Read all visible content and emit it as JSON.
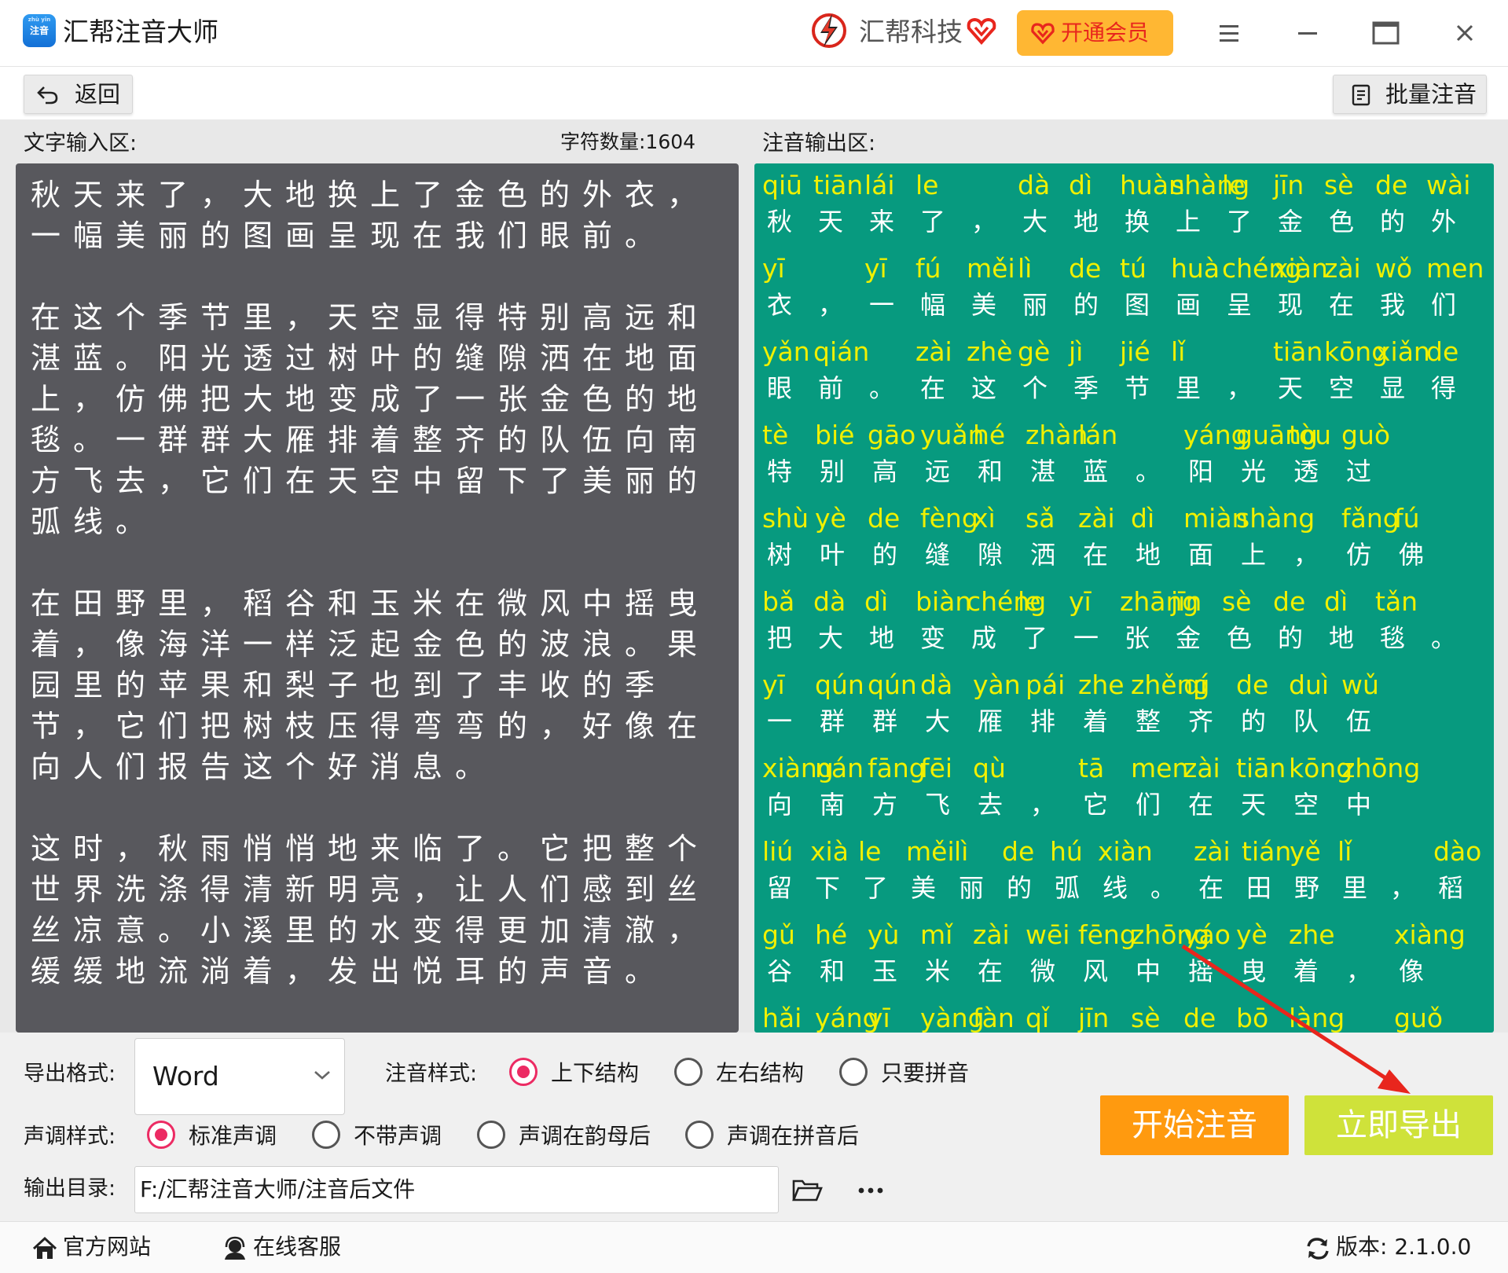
{
  "app": {
    "logo_text": "注音",
    "logo_pinyin": "zhù yīn",
    "title": "汇帮注音大师"
  },
  "brand": {
    "name": "汇帮科技",
    "vip_label": "开通会员"
  },
  "toolbar": {
    "back_label": "返回",
    "batch_label": "批量注音"
  },
  "input": {
    "label": "文字输入区:",
    "char_count": "字符数量:1604",
    "text": "秋天来了，大地换上了金色的外衣，一幅美丽的图画呈现在我们眼前。\n\n在这个季节里，天空显得特别高远和湛蓝。阳光透过树叶的缝隙洒在地面上，仿佛把大地变成了一张金色的地毯。一群群大雁排着整齐的队伍向南方飞去，它们在天空中留下了美丽的弧线。\n\n在田野里，稻谷和玉米在微风中摇曳着，像海洋一样泛起金色的波浪。果园里的苹果和梨子也到了丰收的季节，它们把树枝压得弯弯的，好像在向人们报告这个好消息。\n\n这时，秋雨悄悄地来临了。它把整个世界洗涤得清新明亮，让人们感到丝丝凉意。小溪里的水变得更加清澈，缓缓地流淌着，发出悦耳的声音。"
  },
  "output": {
    "label": "注音输出区:",
    "rows": [
      {
        "pinyin": [
          "qiū",
          "tiān",
          "lái",
          "le",
          "",
          "dà",
          "dì",
          "huàn",
          "shàng",
          "le",
          "jīn",
          "sè",
          "de",
          "wài"
        ],
        "hanzi": [
          "秋",
          "天",
          "来",
          "了",
          "，",
          "大",
          "地",
          "换",
          "上",
          "了",
          "金",
          "色",
          "的",
          "外"
        ]
      },
      {
        "pinyin": [
          "yī",
          "",
          "yī",
          "fú",
          "měi",
          "lì",
          "de",
          "tú",
          "huà",
          "chéng",
          "xiàn",
          "zài",
          "wǒ",
          "men"
        ],
        "hanzi": [
          "衣",
          "，",
          "一",
          "幅",
          "美",
          "丽",
          "的",
          "图",
          "画",
          "呈",
          "现",
          "在",
          "我",
          "们"
        ]
      },
      {
        "pinyin": [
          "yǎn",
          "qián",
          "",
          "zài",
          "zhè",
          "gè",
          "jì",
          "jié",
          "lǐ",
          "",
          "tiān",
          "kōng",
          "xiǎn",
          "de"
        ],
        "hanzi": [
          "眼",
          "前",
          "。",
          "在",
          "这",
          "个",
          "季",
          "节",
          "里",
          "，",
          "天",
          "空",
          "显",
          "得"
        ]
      },
      {
        "pinyin": [
          "tè",
          "bié",
          "gāo",
          "yuǎn",
          "hé",
          "zhàn",
          "lán",
          "",
          "yáng",
          "guāng",
          "tòu",
          "guò"
        ],
        "hanzi": [
          "特",
          "别",
          "高",
          "远",
          "和",
          "湛",
          "蓝",
          "。",
          "阳",
          "光",
          "透",
          "过"
        ]
      },
      {
        "pinyin": [
          "shù",
          "yè",
          "de",
          "fèng",
          "xì",
          "sǎ",
          "zài",
          "dì",
          "miàn",
          "shàng",
          "",
          "fǎng",
          "fú"
        ],
        "hanzi": [
          "树",
          "叶",
          "的",
          "缝",
          "隙",
          "洒",
          "在",
          "地",
          "面",
          "上",
          "，",
          "仿",
          "佛"
        ]
      },
      {
        "pinyin": [
          "bǎ",
          "dà",
          "dì",
          "biàn",
          "chéng",
          "le",
          "yī",
          "zhāng",
          "jīn",
          "sè",
          "de",
          "dì",
          "tǎn",
          ""
        ],
        "hanzi": [
          "把",
          "大",
          "地",
          "变",
          "成",
          "了",
          "一",
          "张",
          "金",
          "色",
          "的",
          "地",
          "毯",
          "。"
        ]
      },
      {
        "pinyin": [
          "yī",
          "qún",
          "qún",
          "dà",
          "yàn",
          "pái",
          "zhe",
          "zhěng",
          "qí",
          "de",
          "duì",
          "wǔ"
        ],
        "hanzi": [
          "一",
          "群",
          "群",
          "大",
          "雁",
          "排",
          "着",
          "整",
          "齐",
          "的",
          "队",
          "伍"
        ]
      },
      {
        "pinyin": [
          "xiàng",
          "nán",
          "fāng",
          "fēi",
          "qù",
          "",
          "tā",
          "men",
          "zài",
          "tiān",
          "kōng",
          "zhōng"
        ],
        "hanzi": [
          "向",
          "南",
          "方",
          "飞",
          "去",
          "，",
          "它",
          "们",
          "在",
          "天",
          "空",
          "中"
        ]
      },
      {
        "pinyin": [
          "liú",
          "xià",
          "le",
          "měi",
          "lì",
          "de",
          "hú",
          "xiàn",
          "",
          "zài",
          "tián",
          "yě",
          "lǐ",
          "",
          "dào"
        ],
        "hanzi": [
          "留",
          "下",
          "了",
          "美",
          "丽",
          "的",
          "弧",
          "线",
          "。",
          "在",
          "田",
          "野",
          "里",
          "，",
          "稻"
        ]
      },
      {
        "pinyin": [
          "gǔ",
          "hé",
          "yù",
          "mǐ",
          "zài",
          "wēi",
          "fēng",
          "zhōng",
          "yáo",
          "yè",
          "zhe",
          "",
          "xiàng"
        ],
        "hanzi": [
          "谷",
          "和",
          "玉",
          "米",
          "在",
          "微",
          "风",
          "中",
          "摇",
          "曳",
          "着",
          "，",
          "像"
        ]
      },
      {
        "pinyin": [
          "hǎi",
          "yáng",
          "yī",
          "yàng",
          "fàn",
          "qǐ",
          "jīn",
          "sè",
          "de",
          "bō",
          "làng",
          "",
          "guǒ"
        ],
        "hanzi": [
          "",
          "",
          "",
          "",
          "",
          "",
          "",
          "",
          "",
          "",
          "",
          "",
          ""
        ]
      }
    ]
  },
  "controls": {
    "format_label": "导出格式:",
    "format_value": "Word",
    "style_label": "注音样式:",
    "style_options": [
      "上下结构",
      "左右结构",
      "只要拼音"
    ],
    "tone_label": "声调样式:",
    "tone_options": [
      "标准声调",
      "不带声调",
      "声调在韵母后",
      "声调在拼音后"
    ],
    "start_label": "开始注音",
    "export_label": "立即导出",
    "dir_label": "输出目录:",
    "dir_value": "F:/汇帮注音大师/注音后文件"
  },
  "status": {
    "website": "官方网站",
    "support": "在线客服",
    "version": "版本: 2.1.0.0"
  },
  "colors": {
    "accent_radio": "#ec2b63",
    "pinyin": "#f0f000",
    "output_bg": "#079a7f",
    "input_bg": "#58585d",
    "start_btn": "#ff9a0f",
    "export_btn": "#cfe23a",
    "vip_btn": "#ffb733"
  },
  "icons": {
    "logo": "app-logo-icon",
    "brand": "lightning-logo-icon",
    "vip": "heart-diamond-icon",
    "back": "undo-arrow-icon",
    "batch": "document-list-icon",
    "folder": "folder-open-icon",
    "more": "ellipsis-icon",
    "home": "home-icon",
    "support": "headset-icon",
    "refresh": "refresh-icon"
  }
}
